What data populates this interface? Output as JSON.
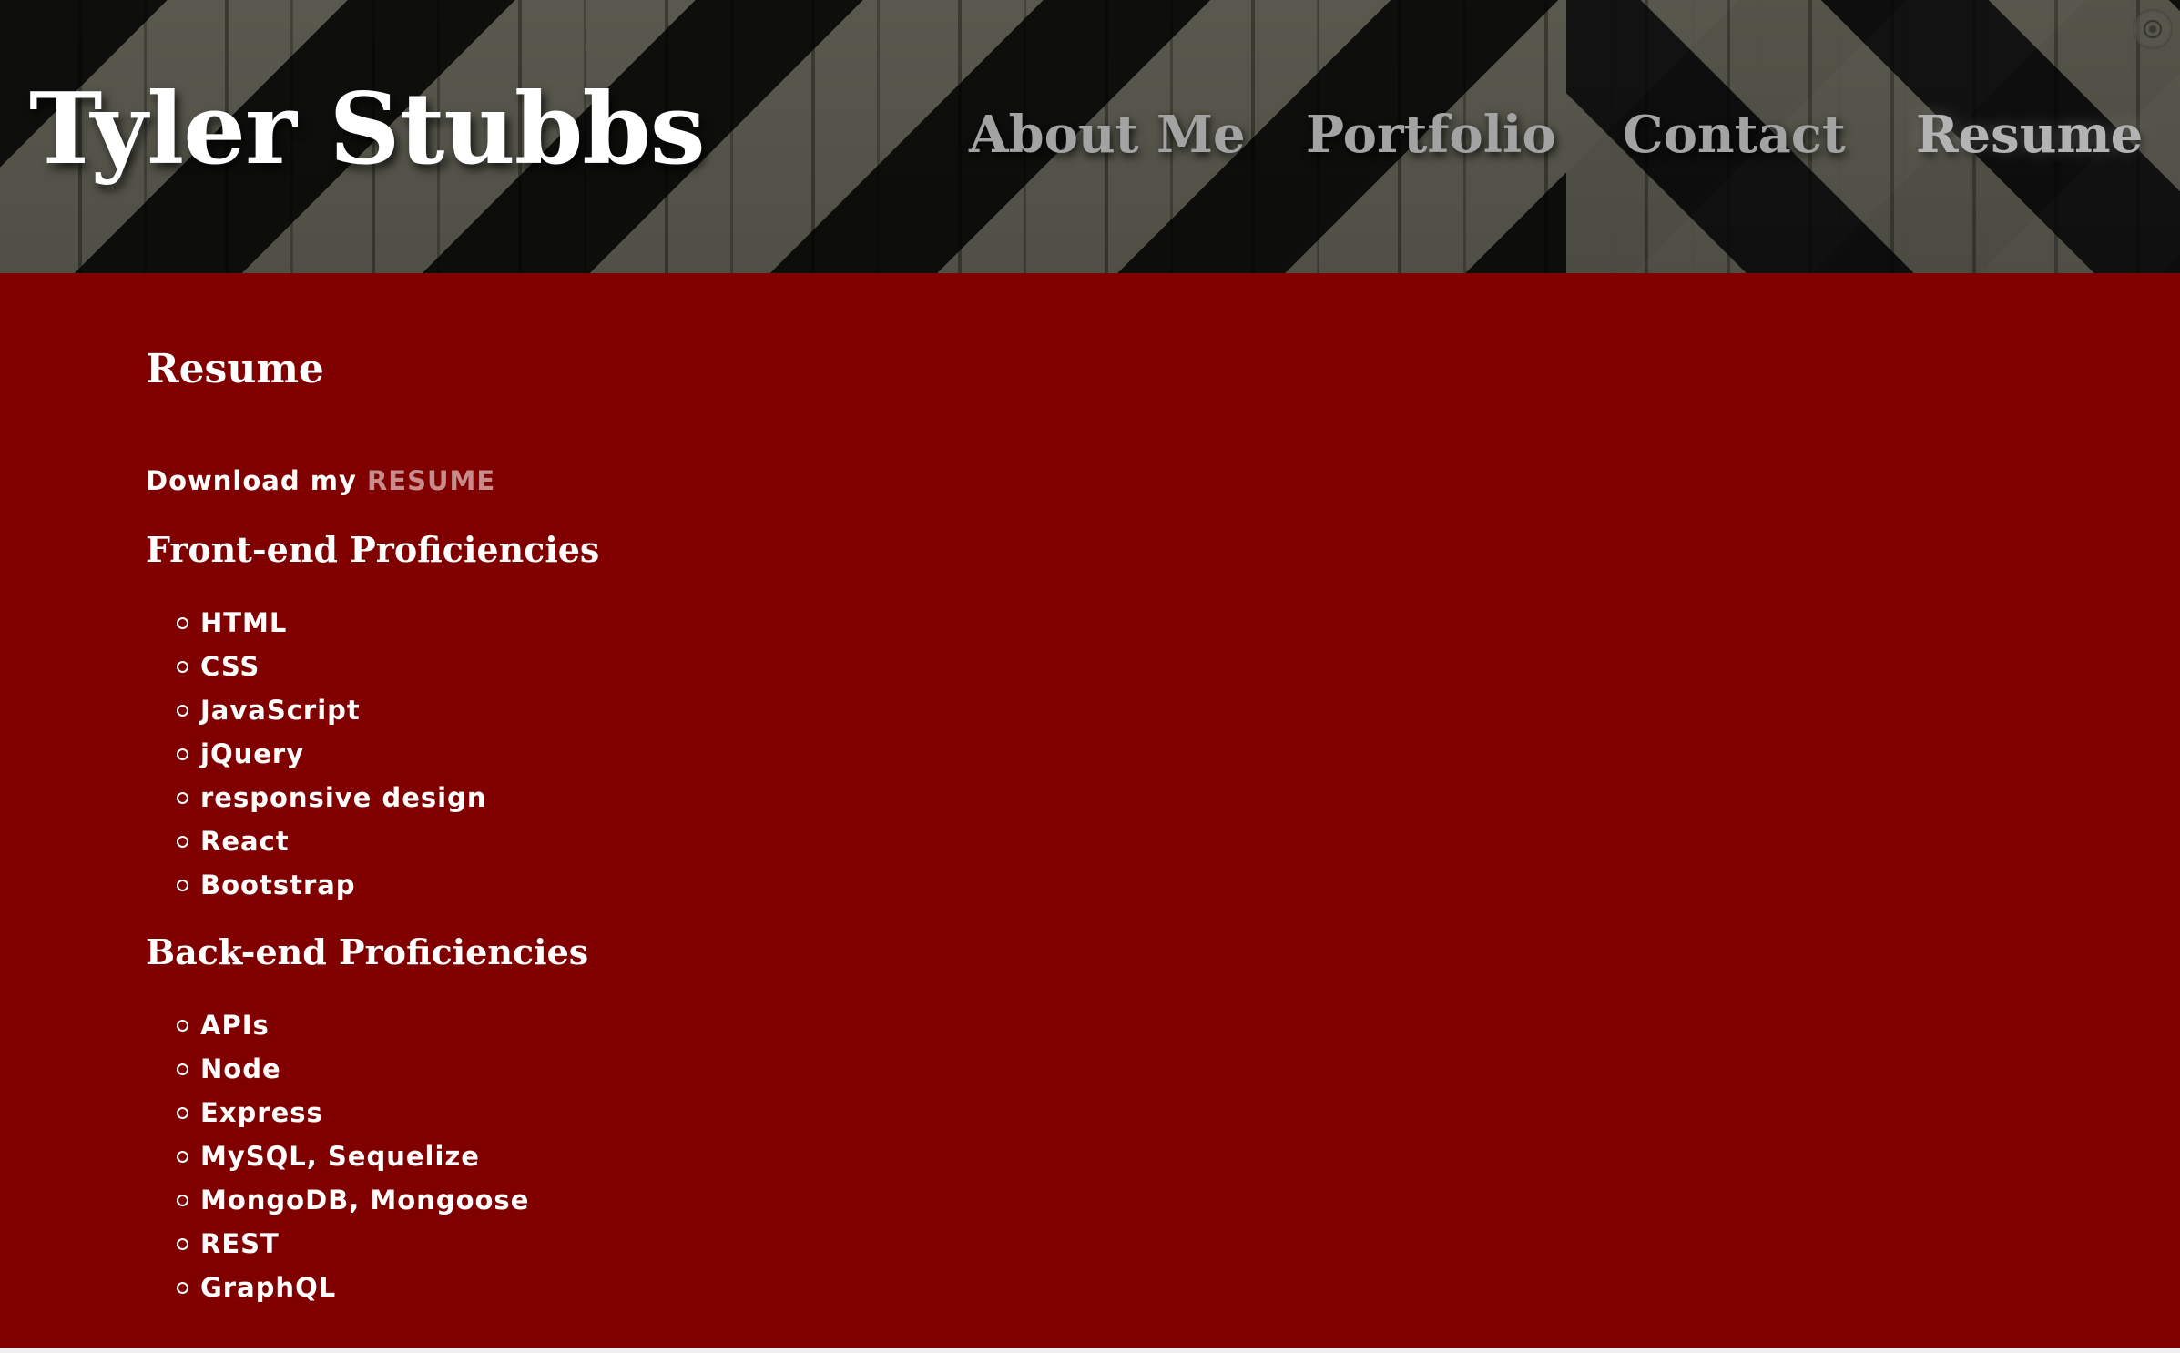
{
  "header": {
    "brand": "Tyler Stubbs",
    "nav": [
      {
        "label": "About Me"
      },
      {
        "label": "Portfolio"
      },
      {
        "label": "Contact"
      },
      {
        "label": "Resume",
        "active": true
      }
    ]
  },
  "main": {
    "title": "Resume",
    "download_prefix": "Download my ",
    "download_link": "RESUME",
    "sections": [
      {
        "heading": "Front-end Proficiencies",
        "items": [
          "HTML",
          "CSS",
          "JavaScript",
          "jQuery",
          "responsive design",
          "React",
          "Bootstrap"
        ]
      },
      {
        "heading": "Back-end Proficiencies",
        "items": [
          "APIs",
          "Node",
          "Express",
          "MySQL, Sequelize",
          "MongoDB, Mongoose",
          "REST",
          "GraphQL"
        ]
      }
    ]
  },
  "colors": {
    "main_background": "#800000",
    "link": "#c98c8c",
    "nav_text": "#a3a3a3",
    "heading_text": "#ffffff"
  },
  "icons": {
    "corner": "camera-icon",
    "list_bullet": "circle-bullet-icon"
  }
}
